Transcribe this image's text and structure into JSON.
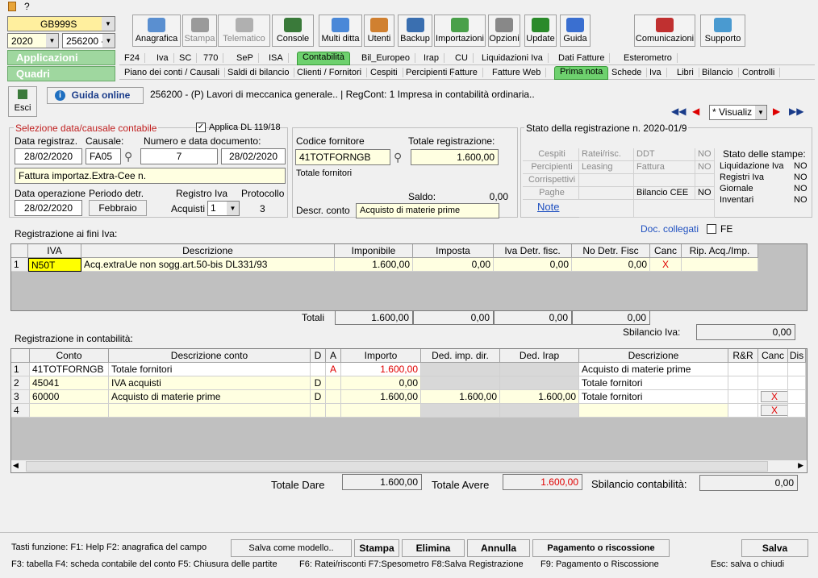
{
  "top": {
    "company_code": "GB999S",
    "year": "2020",
    "company": "256200 -",
    "applicazioni": "Applicazioni",
    "quadri": "Quadri"
  },
  "toolbar": [
    "Anagrafica",
    "Stampa",
    "Telematico",
    "Console",
    "Multi ditta",
    "Utenti",
    "Backup",
    "Importazioni",
    "Opzioni",
    "Update",
    "Guida",
    "Comunicazioni",
    "Supporto"
  ],
  "tabs1": [
    "F24",
    "Iva",
    "SC",
    "770",
    "SeP",
    "ISA",
    "Contabilità",
    "Bil_Europeo",
    "Irap",
    "CU",
    "Liquidazioni Iva",
    "Dati Fatture",
    "Esterometro"
  ],
  "tabs2": [
    "Piano dei conti / Causali",
    "Saldi di bilancio",
    "Clienti / Fornitori",
    "Cespiti",
    "Percipienti",
    "Fatture",
    "Fatture Web",
    "Prima nota",
    "Schede",
    "Iva",
    "Libri",
    "Bilancio",
    "Controlli"
  ],
  "header": {
    "esci": "Esci",
    "guida": "Guida online",
    "title": "256200 - (P) Lavori di meccanica generale.. | RegCont: 1 Impresa  in contabilità ordinaria..",
    "nav_select": "* Visualiz"
  },
  "sel": {
    "legend": "Selezione data/causale contabile",
    "applica": "Applica DL 119/18",
    "data_reg_lbl": "Data registraz.",
    "causale_lbl": "Causale:",
    "numdoc_lbl": "Numero e data documento:",
    "data_reg": "28/02/2020",
    "causale": "FA05",
    "numero": "7",
    "data_doc": "28/02/2020",
    "desc_causale": "Fattura importaz.Extra-Cee n.",
    "data_op_lbl": "Data operazione",
    "periodo_lbl": "Periodo detr.",
    "registro_lbl": "Registro Iva",
    "protocollo_lbl": "Protocollo",
    "data_op": "28/02/2020",
    "periodo": "Febbraio",
    "acquisti_lbl": "Acquisti",
    "registro": "1",
    "protocollo": "3"
  },
  "forn": {
    "codice_lbl": "Codice fornitore",
    "totale_lbl": "Totale registrazione:",
    "codice": "41TOTFORNGB",
    "totale": "1.600,00",
    "nome": "Totale fornitori",
    "saldo_lbl": "Saldo:",
    "saldo": "0,00",
    "descr_lbl": "Descr. conto",
    "descr": "Acquisto di materie prime"
  },
  "stato": {
    "legend": "Stato della registrazione n. 2020-01/9",
    "rows": [
      [
        "Cespiti",
        "Ratei/risc.",
        "DDT",
        "NO"
      ],
      [
        "Percipienti",
        "Leasing",
        "Fattura",
        "NO"
      ],
      [
        "Corrispettivi",
        "",
        "",
        ""
      ],
      [
        "Paghe",
        "",
        "Bilancio CEE",
        "NO"
      ]
    ],
    "note": "Note",
    "stampe_title": "Stato delle stampe:",
    "stampe": [
      [
        "Liquidazione Iva",
        "NO"
      ],
      [
        "Registri Iva",
        "NO"
      ],
      [
        "Giornale",
        "NO"
      ],
      [
        "Inventari",
        "NO"
      ]
    ]
  },
  "doc": {
    "label": "Doc. collegati",
    "fe": "FE"
  },
  "iva": {
    "title": "Registrazione ai fini Iva:",
    "headers": [
      "IVA",
      "Descrizione",
      "Imponibile",
      "Imposta",
      "Iva Detr. fisc.",
      "No Detr. Fisc",
      "Canc",
      "Rip. Acq./Imp."
    ],
    "rows": [
      {
        "n": "1",
        "iva": "N50T",
        "desc": "Acq.extraUe non sogg.art.50-bis DL331/93",
        "imponibile": "1.600,00",
        "imposta": "0,00",
        "detr": "0,00",
        "nodetr": "0,00",
        "canc": "X"
      }
    ],
    "totali_lbl": "Totali",
    "totali": [
      "1.600,00",
      "0,00",
      "0,00",
      "0,00"
    ],
    "sbil_lbl": "Sbilancio Iva:",
    "sbil": "0,00"
  },
  "cont": {
    "title": "Registrazione in contabilità:",
    "headers": [
      "Conto",
      "Descrizione conto",
      "D",
      "A",
      "Importo",
      "Ded. imp. dir.",
      "Ded. Irap",
      "Descrizione",
      "R&R",
      "Canc",
      "Dis"
    ],
    "rows": [
      {
        "n": "1",
        "conto": "41TOTFORNGB",
        "desc": "Totale fornitori",
        "d": "",
        "a": "A",
        "importo": "1.600,00",
        "ded": "",
        "irap": "",
        "descr": "Acquisto di materie prime",
        "canc": ""
      },
      {
        "n": "2",
        "conto": "45041",
        "desc": "IVA acquisti",
        "d": "D",
        "a": "",
        "importo": "0,00",
        "ded": "",
        "irap": "",
        "descr": "Totale fornitori",
        "canc": ""
      },
      {
        "n": "3",
        "conto": "60000",
        "desc": "Acquisto di materie prime",
        "d": "D",
        "a": "",
        "importo": "1.600,00",
        "ded": "1.600,00",
        "irap": "1.600,00",
        "descr": "Totale fornitori",
        "canc": "X"
      },
      {
        "n": "4",
        "conto": "",
        "desc": "",
        "d": "",
        "a": "",
        "importo": "",
        "ded": "",
        "irap": "",
        "descr": "",
        "canc": "X"
      }
    ],
    "dare_lbl": "Totale Dare",
    "dare": "1.600,00",
    "avere_lbl": "Totale Avere",
    "avere": "1.600,00",
    "sbil_lbl": "Sbilancio contabilità:",
    "sbil": "0,00"
  },
  "footer": {
    "tasti": "Tasti funzione: F1: Help  F2: anagrafica del campo",
    "salva_modello": "Salva come modello..",
    "stampa": "Stampa",
    "elimina": "Elimina",
    "annulla": "Annulla",
    "pagamento": "Pagamento o riscossione",
    "salva": "Salva",
    "f3": "F3: tabella   F4: scheda contabile del conto  F5: Chiusura delle partite",
    "f6": "F6: Ratei/risconti   F7:Spesometro   F8:Salva Registrazione",
    "f9": "F9: Pagamento o Riscossione",
    "esc": "Esc: salva o chiudi"
  }
}
